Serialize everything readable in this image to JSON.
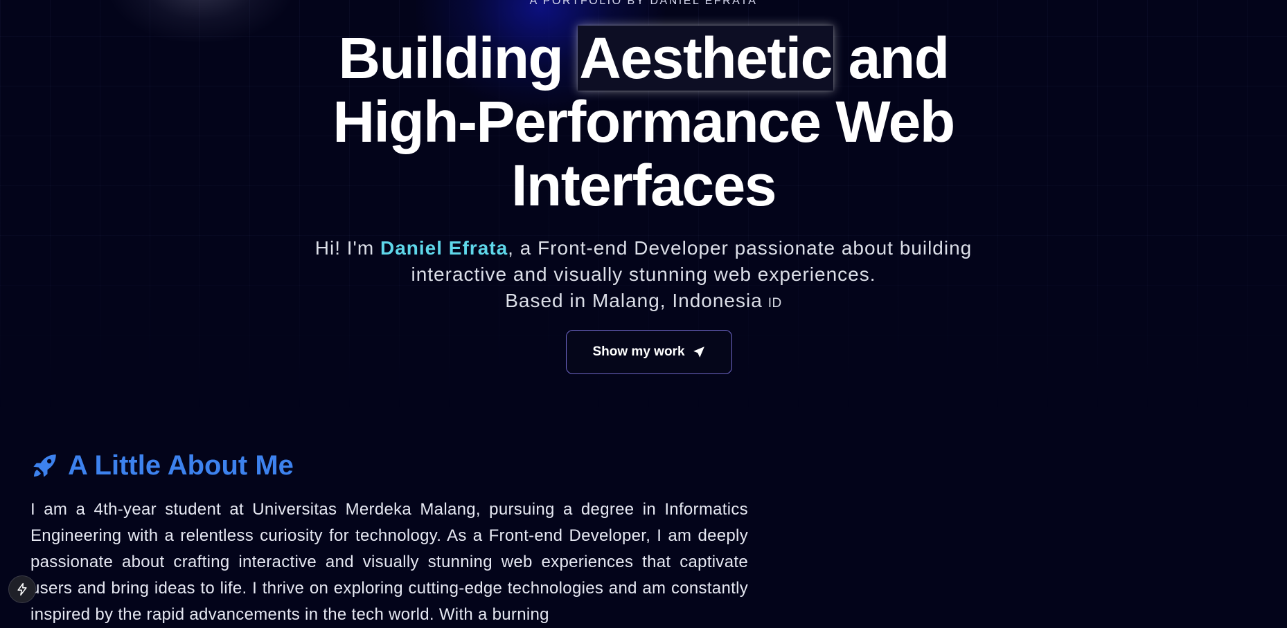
{
  "hero": {
    "eyebrow": "A PORTFOLIO BY DANIEL EFRATA",
    "title_part1": "Building ",
    "title_highlight": "Aesthetic",
    "title_part2": " and",
    "title_line2": "High-Performance Web",
    "title_line3": "Interfaces",
    "intro_prefix": "Hi! I'm ",
    "intro_name": "Daniel Efrata",
    "intro_suffix": ", a Front-end Developer passionate about building",
    "intro_line2": "interactive and visually stunning web experiences.",
    "location": "Based in Malang, Indonesia",
    "flag": "ID",
    "cta_label": "Show my work",
    "cta_icon": "send-icon"
  },
  "about": {
    "heading": "A Little About Me",
    "icon": "rocket-icon",
    "paragraph": "I am a 4th-year student at Universitas Merdeka Malang, pursuing a degree in Informatics Engineering with a relentless curiosity for technology. As a Front-end Developer, I am deeply passionate about crafting interactive and visually stunning web experiences that captivate users and bring ideas to life. I thrive on exploring cutting-edge technologies and am constantly inspired by the rapid advancements in the tech world. With a burning"
  },
  "dev_badge": {
    "icon": "lightning-icon"
  },
  "colors": {
    "background": "#03041a",
    "name_accent": "#5fd7ea",
    "heading_accent": "#3d82ee",
    "button_border": "#6e66c8"
  }
}
